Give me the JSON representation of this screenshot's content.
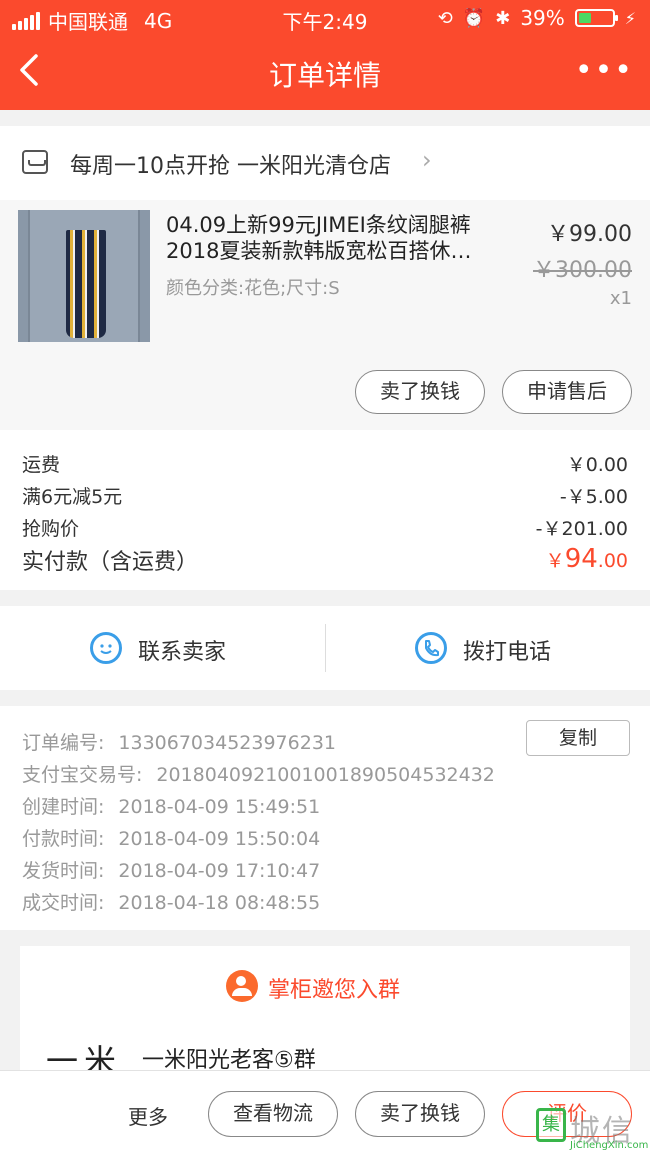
{
  "status_bar": {
    "carrier": "中国联通",
    "network": "4G",
    "time": "下午2:49",
    "battery": "39%",
    "battery_level": 0.39
  },
  "nav": {
    "back_icon": "chevron-left-icon",
    "title": "订单详情",
    "more_label": "•••"
  },
  "store": {
    "icon": "store-icon",
    "name": "每周一10点开抢  一米阳光清仓店",
    "chevron": "›"
  },
  "product": {
    "title": "04.09上新99元JIMEI条纹阔腿裤2018夏装新款韩版宽松百搭休…",
    "spec": "颜色分类:花色;尺寸:S",
    "price": "￥99.00",
    "original_price": "￥300.00",
    "quantity": "x1",
    "actions": {
      "sell_label": "卖了换钱",
      "aftersale_label": "申请售后"
    }
  },
  "fees": {
    "rows": [
      {
        "label": "运费",
        "value": "￥0.00"
      },
      {
        "label": "满6元减5元",
        "value": "-￥5.00"
      },
      {
        "label": "抢购价",
        "value": "-￥201.00"
      }
    ],
    "total_label": "实付款（含运费）",
    "total_currency": "￥",
    "total_int": "94",
    "total_dec": ".00",
    "accent": "#fb4a2d"
  },
  "contact": {
    "seller_label": "联系卖家",
    "seller_icon": "chat-bubble-icon",
    "phone_label": "拨打电话",
    "phone_icon": "phone-icon"
  },
  "order_info": {
    "copy_label": "复制",
    "rows": [
      {
        "label": "订单编号:",
        "value": "133067034523976231"
      },
      {
        "label": "支付宝交易号:",
        "value": "2018040921001001890504532432"
      },
      {
        "label": "创建时间:",
        "value": "2018-04-09 15:49:51"
      },
      {
        "label": "付款时间:",
        "value": "2018-04-09 15:50:04"
      },
      {
        "label": "发货时间:",
        "value": "2018-04-09 17:10:47"
      },
      {
        "label": "成交时间:",
        "value": "2018-04-18 08:48:55"
      }
    ]
  },
  "group_invite": {
    "icon": "group-icon",
    "title": "掌柜邀您入群",
    "brand": "一米",
    "group_name": "一米阳光老客⑤群"
  },
  "bottom_bar": {
    "more_label": "更多",
    "logistics_label": "查看物流",
    "sell_label": "卖了换钱",
    "review_label": "评价"
  },
  "watermark": {
    "glyph": "集",
    "text_cn": "城信",
    "text_en": "JiChengXin.com"
  }
}
